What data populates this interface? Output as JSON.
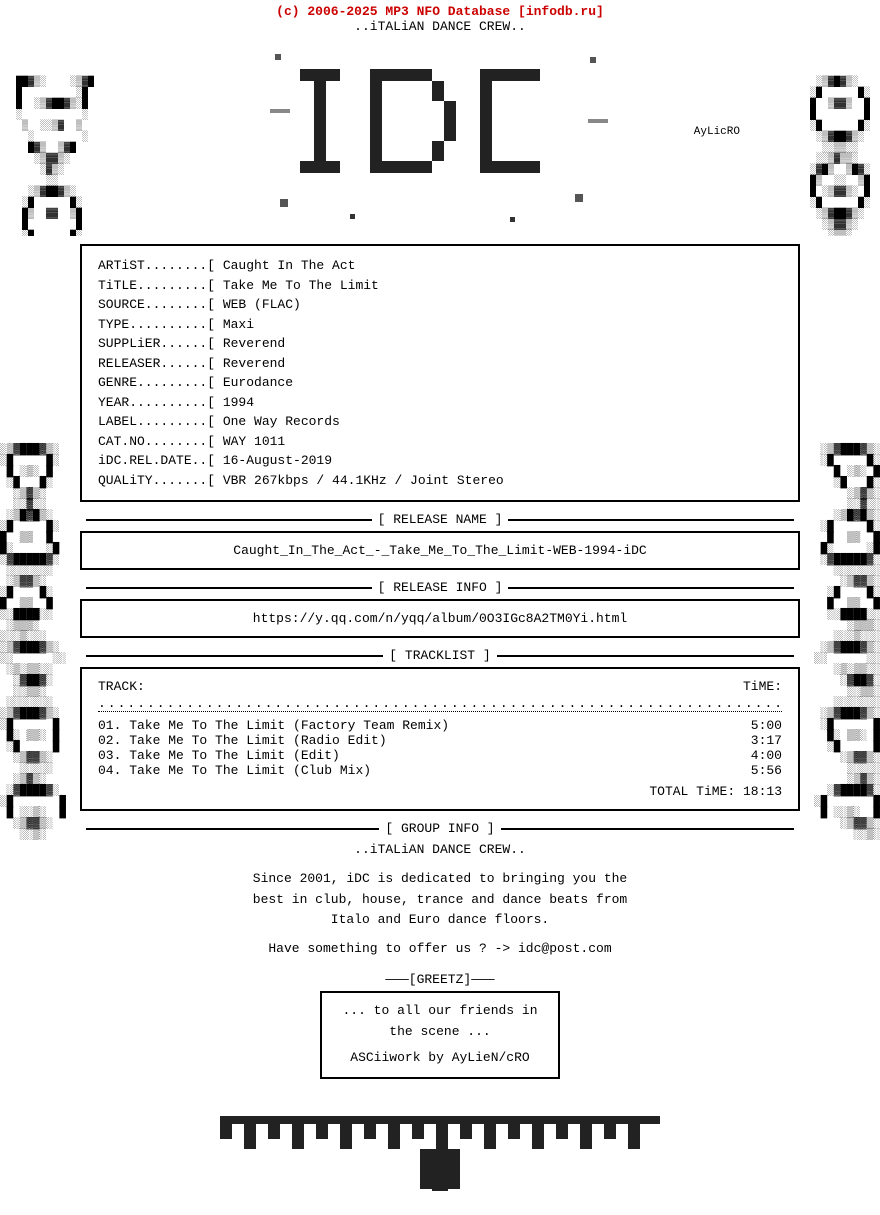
{
  "header": {
    "copyright": "(c) 2006-2025 MP3 NFO Database [infodb.ru]",
    "crew": "..iTALiAN DANCE CREW.."
  },
  "info": {
    "artist_label": "ARTiST",
    "artist_value": "Caught In The Act",
    "title_label": "TiTLE",
    "title_value": "Take Me To The Limit",
    "source_label": "SOURCE",
    "source_value": "WEB (FLAC)",
    "type_label": "TYPE",
    "type_value": "Maxi",
    "supplier_label": "SUPPLiER",
    "supplier_value": "Reverend",
    "releaser_label": "RELEASER",
    "releaser_value": "Reverend",
    "genre_label": "GENRE",
    "genre_value": "Eurodance",
    "year_label": "YEAR",
    "year_value": "1994",
    "label_label": "LABEL",
    "label_value": "One Way Records",
    "catno_label": "CAT.NO.",
    "catno_value": "WAY 1011",
    "reldate_label": "iDC.REL.DATE",
    "reldate_value": "16-August-2019",
    "quality_label": "QUALiTY",
    "quality_value": "VBR 267kbps / 44.1KHz / Joint Stereo"
  },
  "sections": {
    "release_name_header": "[ RELEASE NAME ]",
    "release_name": "Caught_In_The_Act_-_Take_Me_To_The_Limit-WEB-1994-iDC",
    "release_info_header": "[ RELEASE INFO ]",
    "release_info_url": "https://y.qq.com/n/yqq/album/0O3IGc8A2TM0Yi.html",
    "tracklist_header": "[ TRACKLIST ]",
    "track_col": "TRACK:",
    "time_col": "TiME:",
    "tracks": [
      {
        "num": "01",
        "title": "Take Me To The Limit (Factory Team Remix)",
        "time": "5:00"
      },
      {
        "num": "02",
        "title": "Take Me To The Limit (Radio Edit)",
        "time": "3:17"
      },
      {
        "num": "03",
        "title": "Take Me To The Limit (Edit)",
        "time": "4:00"
      },
      {
        "num": "04",
        "title": "Take Me To The Limit (Club Mix)",
        "time": "5:56"
      }
    ],
    "total_time_label": "TOTAL TiME:",
    "total_time": "18:13",
    "group_info_header": "[ GROUP INFO ]",
    "group_name": "..iTALiAN DANCE CREW..",
    "group_desc1": "Since 2001, iDC is dedicated to bringing you the",
    "group_desc2": "best in club, house, trance and dance beats from",
    "group_desc3": "Italo and Euro dance floors.",
    "group_contact": "Have something to offer us ? -> idc@post.com",
    "greetz_title": "[GREETZ]",
    "greetz_line1": "... to all our friends in",
    "greetz_line2": "the scene ...",
    "greetz_line3": "ASCiiwork by AyLieN/cRO"
  }
}
